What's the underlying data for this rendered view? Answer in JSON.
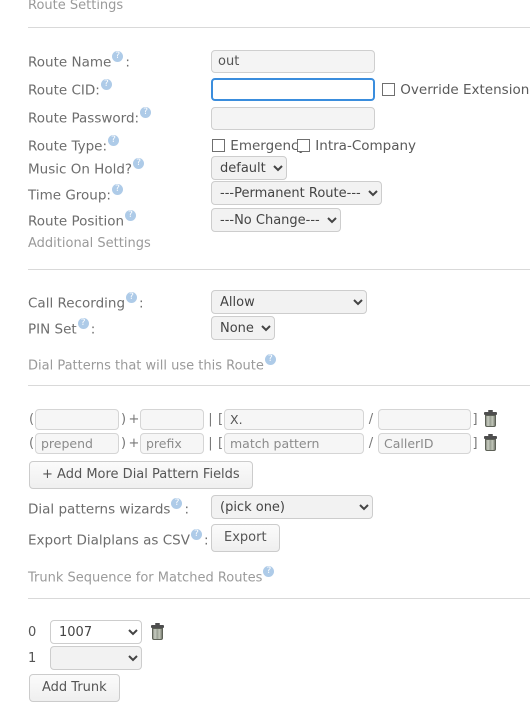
{
  "sections": {
    "route_settings": "Route Settings",
    "additional_settings": "Additional Settings",
    "dial_patterns": "Dial Patterns that will use this Route",
    "trunk_sequence": "Trunk Sequence for Matched Routes"
  },
  "fields": {
    "route_name": {
      "label": "Route Name",
      "colon": ":",
      "value": "out"
    },
    "route_cid": {
      "label": "Route CID:",
      "value": "",
      "focused": true,
      "override_extension_label": "Override Extension",
      "override_extension_checked": false
    },
    "route_password": {
      "label": "Route Password:",
      "value": ""
    },
    "route_type": {
      "label": "Route Type:",
      "emergency_label": "Emergency",
      "emergency_checked": false,
      "intra_company_label": "Intra-Company",
      "intra_company_checked": false
    },
    "music_on_hold": {
      "label": "Music On Hold?",
      "value": "default",
      "options": [
        "default"
      ]
    },
    "time_group": {
      "label": "Time Group:",
      "value": "---Permanent Route---",
      "options": [
        "---Permanent Route---"
      ]
    },
    "route_position": {
      "label": "Route Position",
      "value": "---No Change---",
      "options": [
        "---No Change---"
      ]
    },
    "call_recording": {
      "label": "Call Recording",
      "colon": ":",
      "value": "Allow",
      "options": [
        "Allow"
      ]
    },
    "pin_set": {
      "label": "PIN Set",
      "colon": ":",
      "value": "None",
      "options": [
        "None"
      ]
    },
    "dial_patterns_wizards": {
      "label": "Dial patterns wizards",
      "colon": ":",
      "value": "(pick one)",
      "options": [
        "(pick one)"
      ]
    },
    "export_dialplans": {
      "label": "Export Dialplans as CSV",
      "colon": ":",
      "button": "Export"
    }
  },
  "dial_pattern_table": {
    "separators": {
      "open_paren": "(",
      "close_paren": ")",
      "plus": "+",
      "pipe": "|",
      "bracket_open": "[",
      "slash": "/",
      "bracket_close": "]"
    },
    "rows": [
      {
        "prepend": "",
        "prefix": "",
        "match_pattern": "X.",
        "callerid": "",
        "prepend_ph": "",
        "prefix_ph": "",
        "match_pattern_ph": "",
        "callerid_ph": ""
      },
      {
        "prepend": "",
        "prefix": "",
        "match_pattern": "",
        "callerid": "",
        "prepend_ph": "prepend",
        "prefix_ph": "prefix",
        "match_pattern_ph": "match pattern",
        "callerid_ph": "CallerID"
      }
    ],
    "add_button": "+ Add More Dial Pattern Fields"
  },
  "trunk_table": {
    "rows": [
      {
        "index": "0",
        "value": "1007",
        "options": [
          "1007"
        ],
        "has_trash": true,
        "active": true
      },
      {
        "index": "1",
        "value": "",
        "options": [
          ""
        ],
        "has_trash": false,
        "active": false
      }
    ],
    "add_button": "Add Trunk"
  },
  "colors": {
    "label_text": "#6d6d6d",
    "section_text": "#9a9a9a",
    "focus_border": "#3a8ddd",
    "help_icon": "#aecbe8",
    "divider": "#d9d9d9"
  }
}
